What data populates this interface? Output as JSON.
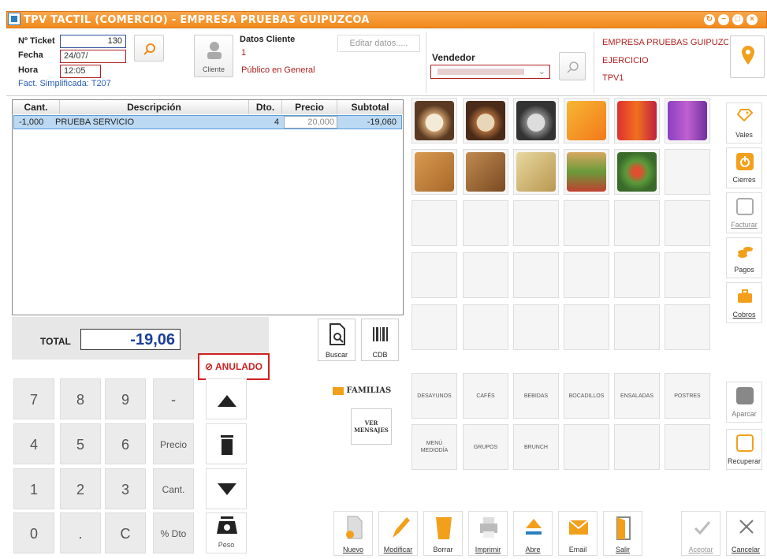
{
  "window": {
    "title": "TPV TACTIL (COMERCIO) - EMPRESA PRUEBAS GUIPUZCOA",
    "controls": [
      "↻",
      "−",
      "□",
      "×"
    ]
  },
  "ticket": {
    "ticket_label": "Nº Ticket",
    "ticket_value": "130",
    "fecha_label": "Fecha",
    "fecha_value": "24/07/",
    "hora_label": "Hora",
    "hora_value": "12:05",
    "fact_simplificada": "Fact. Simplificada: T207"
  },
  "cliente": {
    "button_label": "Cliente",
    "section_title": "Datos Cliente",
    "code": "1",
    "name": "Público en General",
    "edit_placeholder": "Editar datos....."
  },
  "vendedor": {
    "label": "Vendedor",
    "selected": ""
  },
  "empresa": {
    "name": "EMPRESA PRUEBAS GUIPUZC(",
    "ejercicio": "EJERCICIO",
    "tpv": "TPV1"
  },
  "lines_table": {
    "columns": [
      "Cant.",
      "Descripción",
      "Dto.",
      "Precio",
      "Subtotal"
    ],
    "rows": [
      {
        "cant": "-1,000",
        "descripcion": "PRUEBA SERVICIO",
        "dto": "4",
        "precio": "20,000",
        "subtotal": "-19,060"
      }
    ]
  },
  "total": {
    "label": "TOTAL",
    "value": "-19,06",
    "status": "ANULADO"
  },
  "keypad": {
    "keys": [
      "7",
      "8",
      "9",
      "-",
      "4",
      "5",
      "6",
      "Precio",
      "1",
      "2",
      "3",
      "Cant.",
      "0",
      ".",
      "C",
      "% Dto"
    ],
    "peso_label": "Peso"
  },
  "tools": {
    "buscar_label": "Buscar",
    "cdb_label": "CDB",
    "familias_label": "FAMILIAS",
    "ver_mensajes_label": "VER MENSAJES"
  },
  "families": [
    "DESAYUNOS",
    "CAFÉS",
    "BEBIDAS",
    "BOCADILLOS",
    "ENSALADAS",
    "POSTRES",
    "MENÚ MEDIODÍA",
    "GRUPOS",
    "BRUNCH"
  ],
  "products_row1_icons": [
    "coffee-cup-icon",
    "latte-cup-icon",
    "cappuccino-cup-icon",
    "orange-juice-icon",
    "red-drinks-icon",
    "purple-drinks-icon"
  ],
  "products_row2_icons": [
    "croissant-icon",
    "pastry-icon",
    "sandwich-icon",
    "bocadillo-icon",
    "salad-icon"
  ],
  "side_buttons": [
    "Vales",
    "Cierres",
    "Facturar",
    "Pagos",
    "Cobros",
    "Aparcar",
    "Recuperar"
  ],
  "bottom_buttons": [
    "Nuevo",
    "Modificar",
    "Borrar",
    "Imprimir",
    "Abre",
    "Email",
    "Salir",
    "Aceptar",
    "Cancelar"
  ],
  "colors": {
    "accent": "#f28a1b",
    "title_blue": "#2a7fc0",
    "anulado_red": "#d02020",
    "total_blue": "#1a3f9a"
  }
}
